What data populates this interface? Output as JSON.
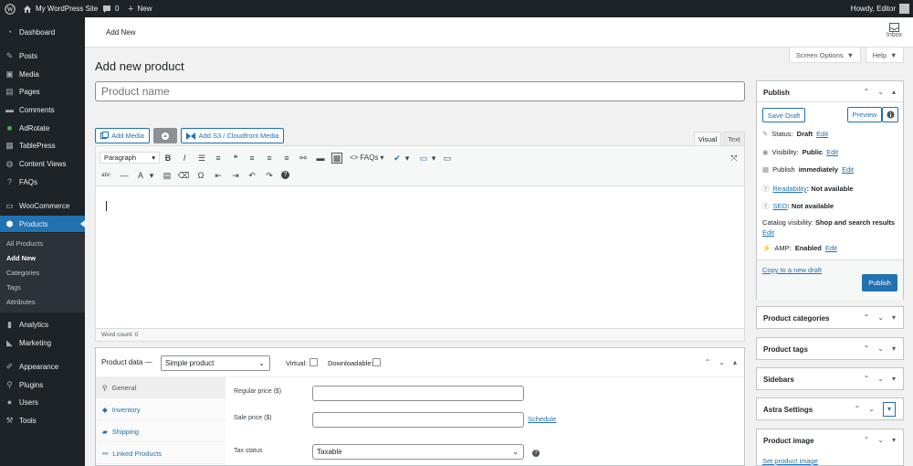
{
  "adminbar": {
    "site": "My WordPress Site",
    "comments": "0",
    "new": "New",
    "howdy": "Howdy, Editor"
  },
  "sidebar": {
    "items": [
      {
        "label": "Dashboard",
        "icon": "dashboard-icon"
      },
      {
        "label": "Posts",
        "icon": "pin-icon"
      },
      {
        "label": "Media",
        "icon": "media-icon"
      },
      {
        "label": "Pages",
        "icon": "pages-icon"
      },
      {
        "label": "Comments",
        "icon": "comments-icon"
      },
      {
        "label": "AdRotate",
        "icon": "adrotate-icon"
      },
      {
        "label": "TablePress",
        "icon": "table-icon"
      },
      {
        "label": "Content Views",
        "icon": "content-views-icon"
      },
      {
        "label": "FAQs",
        "icon": "faq-icon"
      },
      {
        "label": "WooCommerce",
        "icon": "woocommerce-icon"
      },
      {
        "label": "Products",
        "icon": "products-icon"
      }
    ],
    "sub": [
      "All Products",
      "Add New",
      "Categories",
      "Tags",
      "Attributes"
    ],
    "items2": [
      {
        "label": "Analytics",
        "icon": "analytics-icon"
      },
      {
        "label": "Marketing",
        "icon": "marketing-icon"
      },
      {
        "label": "Appearance",
        "icon": "appearance-icon"
      },
      {
        "label": "Plugins",
        "icon": "plugins-icon"
      },
      {
        "label": "Users",
        "icon": "users-icon"
      },
      {
        "label": "Tools",
        "icon": "tools-icon"
      }
    ]
  },
  "topbar": {
    "title": "Add New",
    "inbox": "Inbox"
  },
  "screen_options": "Screen Options",
  "help": "Help",
  "page_title": "Add new product",
  "name_placeholder": "Product name",
  "editor": {
    "add_media": "Add Media",
    "add_s3": "Add S3 / Cloudfront Media",
    "tab_visual": "Visual",
    "tab_text": "Text",
    "format": "Paragraph",
    "faqs": "FAQs",
    "word_count": "Word count: 0"
  },
  "product_data": {
    "label": "Product data —",
    "type": "Simple product",
    "virtual": "Virtual:",
    "downloadable": "Downloadable:",
    "tabs": [
      "General",
      "Inventory",
      "Shipping",
      "Linked Products"
    ],
    "regular_price": "Regular price ($)",
    "sale_price": "Sale price ($)",
    "schedule": "Schedule",
    "tax_status": "Tax status",
    "tax_value": "Taxable"
  },
  "publish": {
    "title": "Publish",
    "save_draft": "Save Draft",
    "preview": "Preview",
    "status_label": "Status:",
    "status": "Draft",
    "edit": "Edit",
    "visibility_label": "Visibility:",
    "visibility": "Public",
    "publish_label": "Publish",
    "publish_when": "immediately",
    "readability_link": "Readability",
    "readability": ": Not available",
    "seo_link": "SEO",
    "seo": ": Not available",
    "catalog_label": "Catalog visibility:",
    "catalog": "Shop and search results",
    "amp_label": "AMP:",
    "amp": "Enabled",
    "copy_draft": "Copy to a new draft",
    "publish_btn": "Publish"
  },
  "boxes": [
    "Product categories",
    "Product tags",
    "Sidebars",
    "Astra Settings",
    "Product image"
  ],
  "set_image": "Set product image",
  "colors": {
    "accent": "#2271b1",
    "admin_dark": "#1d2327",
    "active": "#2271b1"
  }
}
